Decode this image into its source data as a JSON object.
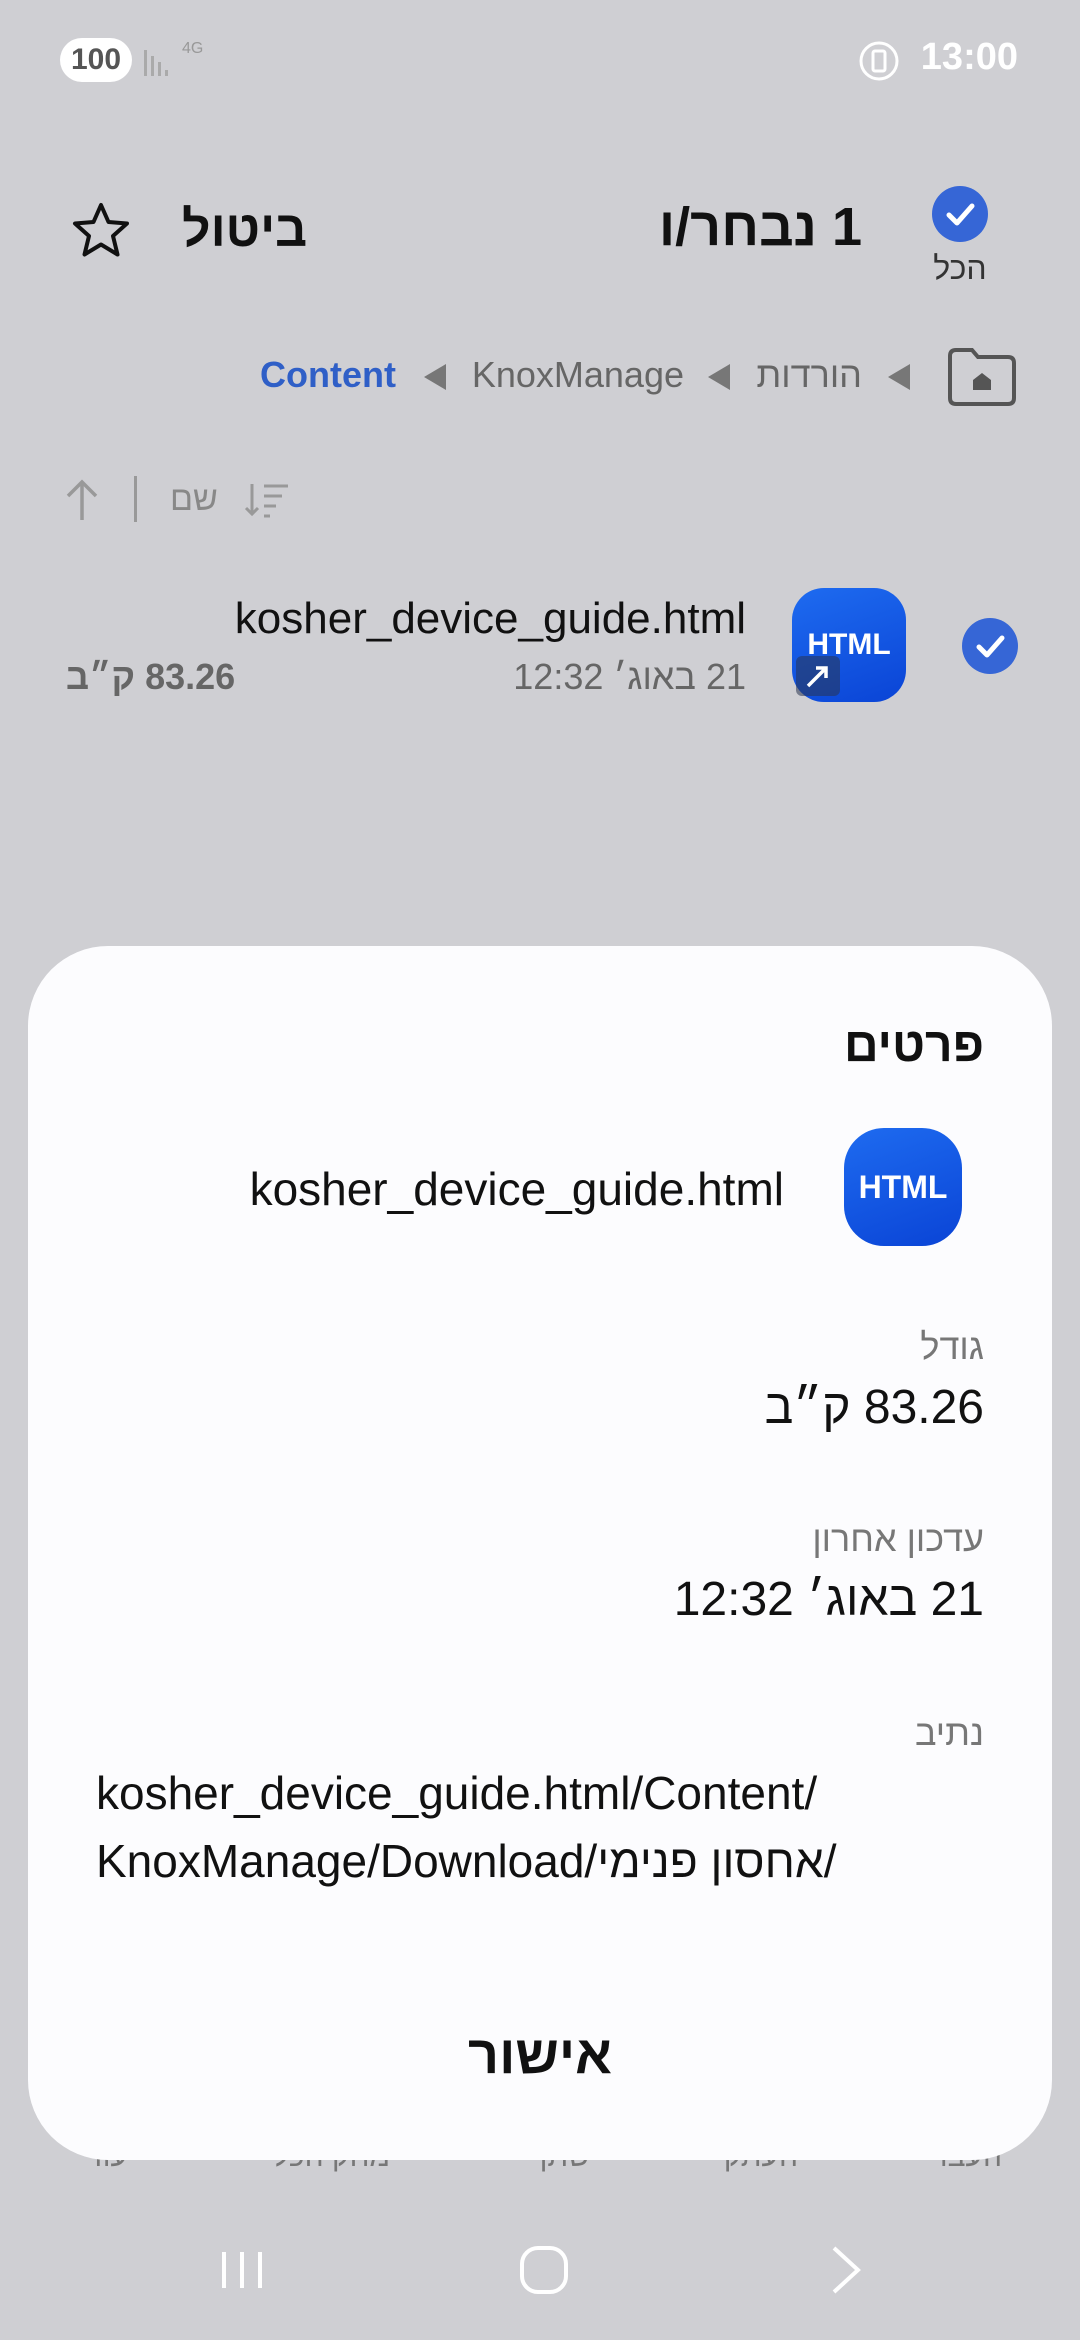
{
  "status_bar": {
    "battery_level": "100",
    "network": "4G",
    "time": "13:00"
  },
  "header": {
    "all_label": "הכל",
    "selected_title": "1 נבחר/ו",
    "cancel_label": "ביטול"
  },
  "breadcrumb": {
    "items": [
      "הורדות",
      "KnoxManage",
      "Content"
    ]
  },
  "sort": {
    "label": "שם"
  },
  "file": {
    "name": "kosher_device_guide.html",
    "date": "21 באוג׳ 12:32",
    "size": "83.26 ק״ב",
    "type_badge": "HTML",
    "checked": true
  },
  "bottom_bar_hidden": [
    "העבר",
    "העתק",
    "שתף",
    "מחק הכל",
    "עוד"
  ],
  "details_dialog": {
    "title": "פרטים",
    "file_badge": "HTML",
    "file_name": "kosher_device_guide.html",
    "size_label": "גודל",
    "size_value": "83.26 ק״ב",
    "modified_label": "עדכון אחרון",
    "modified_value": "21 באוג׳ 12:32",
    "path_label": "נתיב",
    "path_line1": "kosher_device_guide.html/Content/",
    "path_line2": "KnoxManage/Download/אחסון פנימי/",
    "ok_label": "אישור"
  },
  "colors": {
    "accent": "#3666d6",
    "breadcrumb_active": "#2f5fc7",
    "scrim": "#cfcfd3",
    "sheet": "#fcfcfe"
  },
  "icons": [
    "star-icon",
    "home-folder-icon",
    "sort-icon",
    "sort-direction-icon",
    "checkmark-icon",
    "shortcut-arrow-icon",
    "nav-recents-icon",
    "nav-home-icon",
    "nav-back-icon"
  ]
}
